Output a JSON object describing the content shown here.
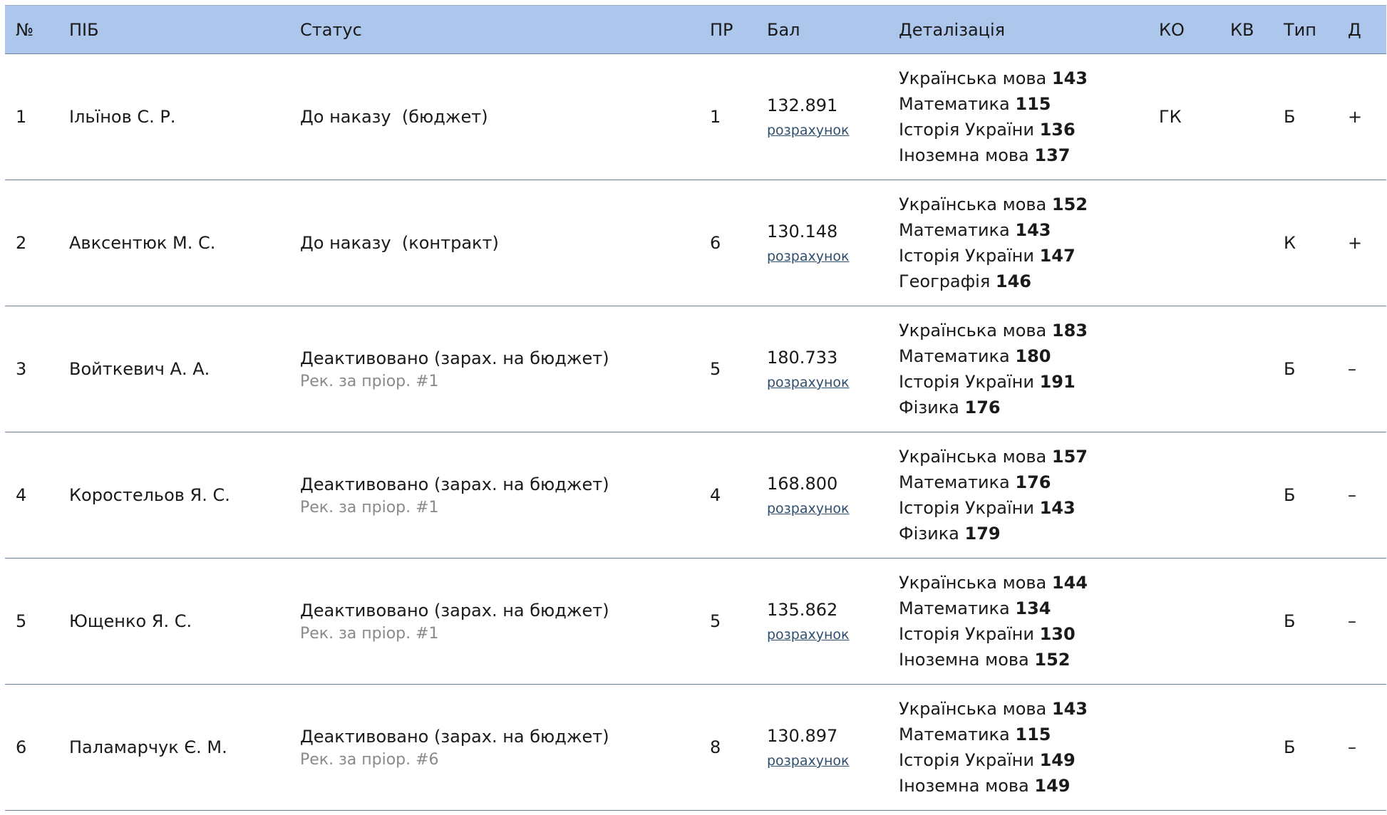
{
  "columns": [
    "№",
    "ПІБ",
    "Статус",
    "ПР",
    "Бал",
    "Деталізація",
    "КО",
    "КВ",
    "Тип",
    "Д"
  ],
  "calc_link_label": "розрахунок",
  "rows": [
    {
      "num": "1",
      "name": "Ільїнов С. Р.",
      "status": "До наказу  (бюджет)",
      "status_note": "",
      "pr": "1",
      "score": "132.891",
      "details": [
        {
          "subject": "Українська мова",
          "score": "143"
        },
        {
          "subject": "Математика",
          "score": "115"
        },
        {
          "subject": "Історія України",
          "score": "136"
        },
        {
          "subject": "Іноземна мова",
          "score": "137"
        }
      ],
      "ko": "ГК",
      "kv": "",
      "type": "Б",
      "d": "+"
    },
    {
      "num": "2",
      "name": "Авксентюк М. С.",
      "status": "До наказу  (контракт)",
      "status_note": "",
      "pr": "6",
      "score": "130.148",
      "details": [
        {
          "subject": "Українська мова",
          "score": "152"
        },
        {
          "subject": "Математика",
          "score": "143"
        },
        {
          "subject": "Історія України",
          "score": "147"
        },
        {
          "subject": "Географія",
          "score": "146"
        }
      ],
      "ko": "",
      "kv": "",
      "type": "К",
      "d": "+"
    },
    {
      "num": "3",
      "name": "Войткевич А. А.",
      "status": "Деактивовано (зарах. на бюджет)",
      "status_note": "Рек. за пріор. #1",
      "pr": "5",
      "score": "180.733",
      "details": [
        {
          "subject": "Українська мова",
          "score": "183"
        },
        {
          "subject": "Математика",
          "score": "180"
        },
        {
          "subject": "Історія України",
          "score": "191"
        },
        {
          "subject": "Фізика",
          "score": "176"
        }
      ],
      "ko": "",
      "kv": "",
      "type": "Б",
      "d": "–"
    },
    {
      "num": "4",
      "name": "Коростельов Я. С.",
      "status": "Деактивовано (зарах. на бюджет)",
      "status_note": "Рек. за пріор. #1",
      "pr": "4",
      "score": "168.800",
      "details": [
        {
          "subject": "Українська мова",
          "score": "157"
        },
        {
          "subject": "Математика",
          "score": "176"
        },
        {
          "subject": "Історія України",
          "score": "143"
        },
        {
          "subject": "Фізика",
          "score": "179"
        }
      ],
      "ko": "",
      "kv": "",
      "type": "Б",
      "d": "–"
    },
    {
      "num": "5",
      "name": "Ющенко Я. С.",
      "status": "Деактивовано (зарах. на бюджет)",
      "status_note": "Рек. за пріор. #1",
      "pr": "5",
      "score": "135.862",
      "details": [
        {
          "subject": "Українська мова",
          "score": "144"
        },
        {
          "subject": "Математика",
          "score": "134"
        },
        {
          "subject": "Історія України",
          "score": "130"
        },
        {
          "subject": "Іноземна мова",
          "score": "152"
        }
      ],
      "ko": "",
      "kv": "",
      "type": "Б",
      "d": "–"
    },
    {
      "num": "6",
      "name": "Паламарчук Є. М.",
      "status": "Деактивовано (зарах. на бюджет)",
      "status_note": "Рек. за пріор. #6",
      "pr": "8",
      "score": "130.897",
      "details": [
        {
          "subject": "Українська мова",
          "score": "143"
        },
        {
          "subject": "Математика",
          "score": "115"
        },
        {
          "subject": "Історія України",
          "score": "149"
        },
        {
          "subject": "Іноземна мова",
          "score": "149"
        }
      ],
      "ko": "",
      "kv": "",
      "type": "Б",
      "d": "–"
    }
  ]
}
